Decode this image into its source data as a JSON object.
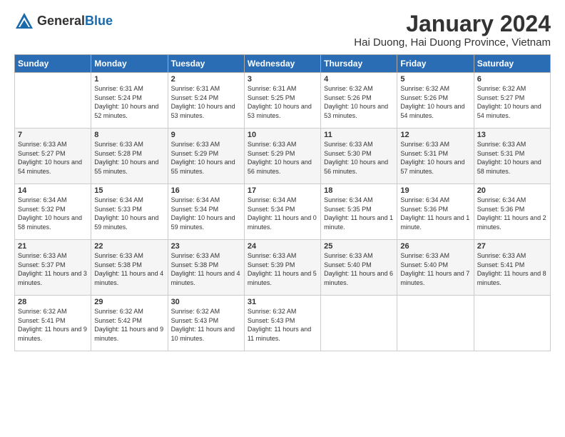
{
  "header": {
    "logo_general": "General",
    "logo_blue": "Blue",
    "month_title": "January 2024",
    "location": "Hai Duong, Hai Duong Province, Vietnam"
  },
  "days_of_week": [
    "Sunday",
    "Monday",
    "Tuesday",
    "Wednesday",
    "Thursday",
    "Friday",
    "Saturday"
  ],
  "weeks": [
    [
      {
        "day": "",
        "sunrise": "",
        "sunset": "",
        "daylight": ""
      },
      {
        "day": "1",
        "sunrise": "Sunrise: 6:31 AM",
        "sunset": "Sunset: 5:24 PM",
        "daylight": "Daylight: 10 hours and 52 minutes."
      },
      {
        "day": "2",
        "sunrise": "Sunrise: 6:31 AM",
        "sunset": "Sunset: 5:24 PM",
        "daylight": "Daylight: 10 hours and 53 minutes."
      },
      {
        "day": "3",
        "sunrise": "Sunrise: 6:31 AM",
        "sunset": "Sunset: 5:25 PM",
        "daylight": "Daylight: 10 hours and 53 minutes."
      },
      {
        "day": "4",
        "sunrise": "Sunrise: 6:32 AM",
        "sunset": "Sunset: 5:26 PM",
        "daylight": "Daylight: 10 hours and 53 minutes."
      },
      {
        "day": "5",
        "sunrise": "Sunrise: 6:32 AM",
        "sunset": "Sunset: 5:26 PM",
        "daylight": "Daylight: 10 hours and 54 minutes."
      },
      {
        "day": "6",
        "sunrise": "Sunrise: 6:32 AM",
        "sunset": "Sunset: 5:27 PM",
        "daylight": "Daylight: 10 hours and 54 minutes."
      }
    ],
    [
      {
        "day": "7",
        "sunrise": "Sunrise: 6:33 AM",
        "sunset": "Sunset: 5:27 PM",
        "daylight": "Daylight: 10 hours and 54 minutes."
      },
      {
        "day": "8",
        "sunrise": "Sunrise: 6:33 AM",
        "sunset": "Sunset: 5:28 PM",
        "daylight": "Daylight: 10 hours and 55 minutes."
      },
      {
        "day": "9",
        "sunrise": "Sunrise: 6:33 AM",
        "sunset": "Sunset: 5:29 PM",
        "daylight": "Daylight: 10 hours and 55 minutes."
      },
      {
        "day": "10",
        "sunrise": "Sunrise: 6:33 AM",
        "sunset": "Sunset: 5:29 PM",
        "daylight": "Daylight: 10 hours and 56 minutes."
      },
      {
        "day": "11",
        "sunrise": "Sunrise: 6:33 AM",
        "sunset": "Sunset: 5:30 PM",
        "daylight": "Daylight: 10 hours and 56 minutes."
      },
      {
        "day": "12",
        "sunrise": "Sunrise: 6:33 AM",
        "sunset": "Sunset: 5:31 PM",
        "daylight": "Daylight: 10 hours and 57 minutes."
      },
      {
        "day": "13",
        "sunrise": "Sunrise: 6:33 AM",
        "sunset": "Sunset: 5:31 PM",
        "daylight": "Daylight: 10 hours and 58 minutes."
      }
    ],
    [
      {
        "day": "14",
        "sunrise": "Sunrise: 6:34 AM",
        "sunset": "Sunset: 5:32 PM",
        "daylight": "Daylight: 10 hours and 58 minutes."
      },
      {
        "day": "15",
        "sunrise": "Sunrise: 6:34 AM",
        "sunset": "Sunset: 5:33 PM",
        "daylight": "Daylight: 10 hours and 59 minutes."
      },
      {
        "day": "16",
        "sunrise": "Sunrise: 6:34 AM",
        "sunset": "Sunset: 5:34 PM",
        "daylight": "Daylight: 10 hours and 59 minutes."
      },
      {
        "day": "17",
        "sunrise": "Sunrise: 6:34 AM",
        "sunset": "Sunset: 5:34 PM",
        "daylight": "Daylight: 11 hours and 0 minutes."
      },
      {
        "day": "18",
        "sunrise": "Sunrise: 6:34 AM",
        "sunset": "Sunset: 5:35 PM",
        "daylight": "Daylight: 11 hours and 1 minute."
      },
      {
        "day": "19",
        "sunrise": "Sunrise: 6:34 AM",
        "sunset": "Sunset: 5:36 PM",
        "daylight": "Daylight: 11 hours and 1 minute."
      },
      {
        "day": "20",
        "sunrise": "Sunrise: 6:34 AM",
        "sunset": "Sunset: 5:36 PM",
        "daylight": "Daylight: 11 hours and 2 minutes."
      }
    ],
    [
      {
        "day": "21",
        "sunrise": "Sunrise: 6:33 AM",
        "sunset": "Sunset: 5:37 PM",
        "daylight": "Daylight: 11 hours and 3 minutes."
      },
      {
        "day": "22",
        "sunrise": "Sunrise: 6:33 AM",
        "sunset": "Sunset: 5:38 PM",
        "daylight": "Daylight: 11 hours and 4 minutes."
      },
      {
        "day": "23",
        "sunrise": "Sunrise: 6:33 AM",
        "sunset": "Sunset: 5:38 PM",
        "daylight": "Daylight: 11 hours and 4 minutes."
      },
      {
        "day": "24",
        "sunrise": "Sunrise: 6:33 AM",
        "sunset": "Sunset: 5:39 PM",
        "daylight": "Daylight: 11 hours and 5 minutes."
      },
      {
        "day": "25",
        "sunrise": "Sunrise: 6:33 AM",
        "sunset": "Sunset: 5:40 PM",
        "daylight": "Daylight: 11 hours and 6 minutes."
      },
      {
        "day": "26",
        "sunrise": "Sunrise: 6:33 AM",
        "sunset": "Sunset: 5:40 PM",
        "daylight": "Daylight: 11 hours and 7 minutes."
      },
      {
        "day": "27",
        "sunrise": "Sunrise: 6:33 AM",
        "sunset": "Sunset: 5:41 PM",
        "daylight": "Daylight: 11 hours and 8 minutes."
      }
    ],
    [
      {
        "day": "28",
        "sunrise": "Sunrise: 6:32 AM",
        "sunset": "Sunset: 5:41 PM",
        "daylight": "Daylight: 11 hours and 9 minutes."
      },
      {
        "day": "29",
        "sunrise": "Sunrise: 6:32 AM",
        "sunset": "Sunset: 5:42 PM",
        "daylight": "Daylight: 11 hours and 9 minutes."
      },
      {
        "day": "30",
        "sunrise": "Sunrise: 6:32 AM",
        "sunset": "Sunset: 5:43 PM",
        "daylight": "Daylight: 11 hours and 10 minutes."
      },
      {
        "day": "31",
        "sunrise": "Sunrise: 6:32 AM",
        "sunset": "Sunset: 5:43 PM",
        "daylight": "Daylight: 11 hours and 11 minutes."
      },
      {
        "day": "",
        "sunrise": "",
        "sunset": "",
        "daylight": ""
      },
      {
        "day": "",
        "sunrise": "",
        "sunset": "",
        "daylight": ""
      },
      {
        "day": "",
        "sunrise": "",
        "sunset": "",
        "daylight": ""
      }
    ]
  ]
}
